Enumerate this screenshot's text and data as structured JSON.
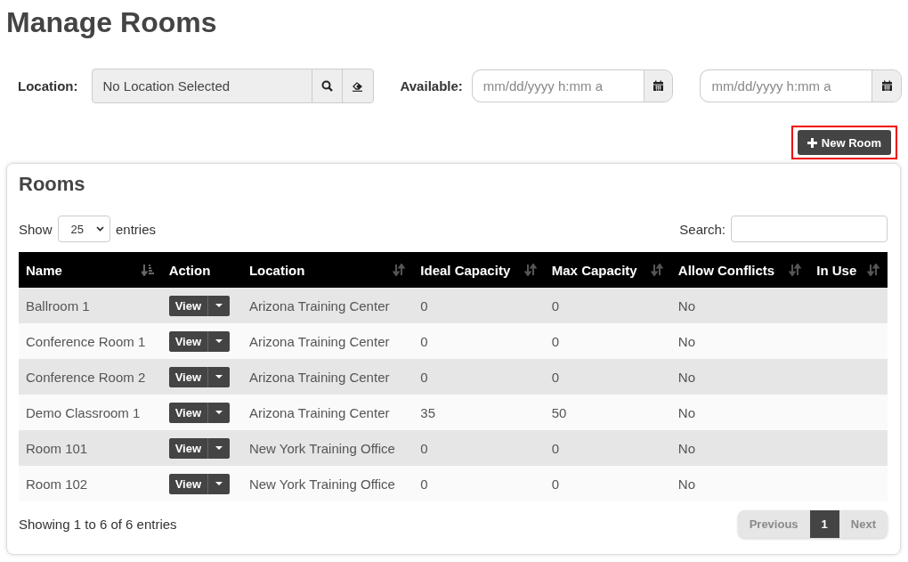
{
  "page_title": "Manage Rooms",
  "filters": {
    "location_label": "Location:",
    "location_value": "No Location Selected",
    "available_label": "Available:",
    "date_from": {
      "placeholder": "mm/dd/yyyy h:mm a"
    },
    "date_to": {
      "placeholder": "mm/dd/yyyy h:mm a"
    }
  },
  "new_button": {
    "label": "New Room",
    "highlighted": true
  },
  "panel": {
    "title": "Rooms",
    "show_label": "Show",
    "page_size": "25",
    "entries_label": "entries",
    "search_label": "Search:",
    "table": {
      "columns": [
        {
          "label": "Name",
          "sorted": true
        },
        {
          "label": "Action",
          "sortable": false
        },
        {
          "label": "Location",
          "sorted": false
        },
        {
          "label": "Ideal Capacity",
          "sorted": false
        },
        {
          "label": "Max Capacity",
          "sorted": false
        },
        {
          "label": "Allow Conflicts",
          "sorted": false
        },
        {
          "label": "In Use",
          "sorted": false
        }
      ],
      "rows": [
        {
          "name": "Ballroom 1",
          "action": "View",
          "location": "Arizona Training Center",
          "ideal": "0",
          "max": "0",
          "conflicts": "No"
        },
        {
          "name": "Conference Room 1",
          "action": "View",
          "location": "Arizona Training Center",
          "ideal": "0",
          "max": "0",
          "conflicts": "No"
        },
        {
          "name": "Conference Room 2",
          "action": "View",
          "location": "Arizona Training Center",
          "ideal": "0",
          "max": "0",
          "conflicts": "No"
        },
        {
          "name": "Demo Classroom 1",
          "action": "View",
          "location": "Arizona Training Center",
          "ideal": "35",
          "max": "50",
          "conflicts": "No"
        },
        {
          "name": "Room 101",
          "action": "View",
          "location": "New York Training Office",
          "ideal": "0",
          "max": "0",
          "conflicts": "No"
        },
        {
          "name": "Room 102",
          "action": "View",
          "location": "New York Training Office",
          "ideal": "0",
          "max": "0",
          "conflicts": "No"
        }
      ]
    },
    "info": "Showing 1 to 6 of 6 entries",
    "pagination": [
      {
        "label": "Previous",
        "disabled": true,
        "selected": false
      },
      {
        "label": "1",
        "disabled": false,
        "selected": true
      },
      {
        "label": "Next",
        "disabled": true,
        "selected": false
      }
    ]
  }
}
